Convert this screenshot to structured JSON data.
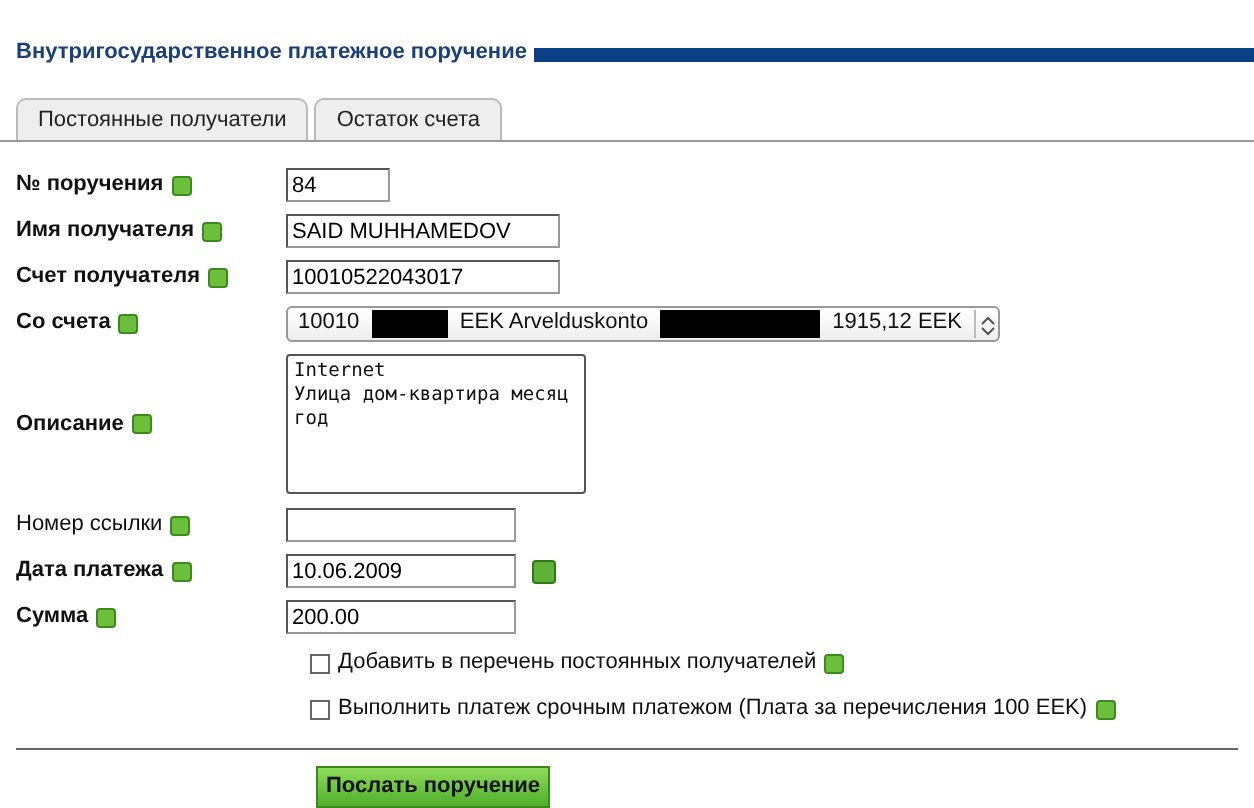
{
  "title": "Внутригосударственное платежное поручение",
  "tabs": [
    {
      "label": "Постоянные получатели",
      "selected": false
    },
    {
      "label": "Остаток счета",
      "selected": false
    }
  ],
  "fields": [
    {
      "kind": "text",
      "label": "№ поручения",
      "required": true,
      "value": "84"
    },
    {
      "kind": "text",
      "label": "Имя получателя",
      "required": true,
      "value": "SAID MUHHAMEDOV"
    },
    {
      "kind": "text",
      "label": "Счет получателя",
      "required": true,
      "value": "10010522043017"
    },
    {
      "kind": "select",
      "label": "Со счета",
      "required": true,
      "parts": [
        "10010",
        "EEK Arvelduskonto",
        "1915,12 EEK"
      ]
    },
    {
      "kind": "textarea",
      "label": "Описание",
      "required": true,
      "lines": [
        "Internet",
        "Улица дом-квартира месяц",
        "год"
      ]
    },
    {
      "kind": "text",
      "label": "Номер ссылки",
      "required": false
    },
    {
      "kind": "date",
      "label": "Дата платежа",
      "required": true,
      "value": "10.06.2009"
    },
    {
      "kind": "text",
      "label": "Сумма",
      "required": true,
      "value": "200.00"
    }
  ],
  "options": [
    {
      "label": "Добавить в перечень постоянных получателей",
      "checked": false
    },
    {
      "label": "Выполнить платеж срочным платежом (Плата за перечисления 100 EEK)",
      "checked": false
    }
  ],
  "submit": "Послать поручение"
}
